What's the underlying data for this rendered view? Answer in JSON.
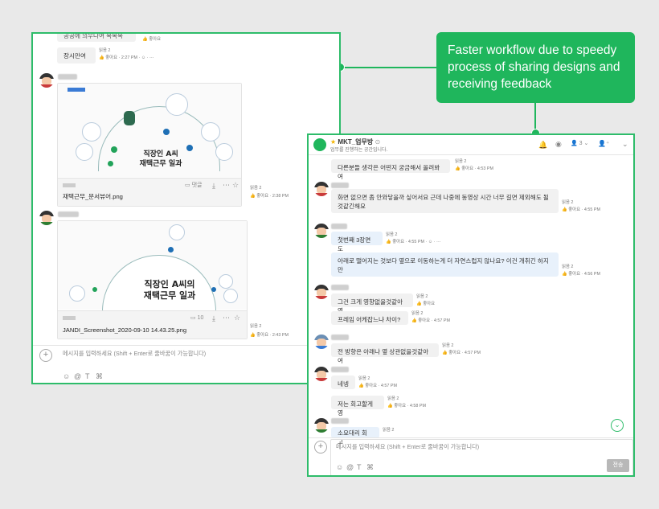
{
  "callout": {
    "text": "Faster workflow due to speedy process of sharing designs and receiving feedback"
  },
  "left": {
    "top_bubble_partial": "공공에 의우나여 목목목",
    "top_bubble_meta": "좋아요",
    "msg1": {
      "text": "장시만여",
      "read": "읽음 2",
      "like": "좋아요",
      "time": "2:27 PM"
    },
    "file1": {
      "image_title_line1": "직장인 A씨",
      "image_title_line2": "재택근무 일과",
      "comment_label": "댓글",
      "filename": "재택근무_문서뷰어.png",
      "read": "읽음 2",
      "like": "좋아요",
      "time": "2:38 PM"
    },
    "file2": {
      "image_title_line1": "직장인 A씨의",
      "image_title_line2": "재택근무 일과",
      "comment_count": "10",
      "filename": "JANDI_Screenshot_2020-09-10 14.43.25.png",
      "read": "읽음 2",
      "like": "좋아요",
      "time": "2:43 PM"
    },
    "input": {
      "placeholder": "메시지를 입력하세요 (Shift + Enter로 줄바꿈이 가능합니다)"
    }
  },
  "right": {
    "header": {
      "title": "MKT_업무방",
      "subtitle": "업무를 진행하는 공간입니다.",
      "member_count": "3"
    },
    "messages": [
      {
        "text": "다른분들 생각은 어떤지 궁금해서 올려봐여",
        "read": "읽음 2",
        "like": "좋아요",
        "time": "4:53 PM"
      },
      {
        "text": "화면 없으면 좀 안와닿을까 싶어서요 근데 나중에 동영상 시간 너무 길면 제외해도 될 것같긴해요",
        "read": "읽음 2",
        "like": "좋아요",
        "time": "4:55 PM"
      },
      {
        "text": "첫번째 3장면도",
        "read": "읽음 2",
        "like": "좋아요",
        "time": "4:55 PM"
      },
      {
        "text": "아래로 떨어지는 것보다 옆으로 이동하는게 더 자연스럽지 않나요? 이건 개취긴 하지만",
        "read": "읽음 2",
        "like": "좋아요",
        "time": "4:56 PM"
      },
      {
        "text": "그건 크게 영향없을것같아영",
        "read": "읽음 2",
        "like": "좋아요",
        "time": ""
      },
      {
        "text": "프레임 어케잡느냐 차이?",
        "read": "읽음 2",
        "like": "좋아요",
        "time": "4:57 PM"
      },
      {
        "text": "전 방향은 아래나 옆 상관없을것같아여",
        "read": "읽음 2",
        "like": "좋아요",
        "time": "4:57 PM"
      },
      {
        "text": "네넹",
        "read": "읽음 2",
        "like": "좋아요",
        "time": "4:57 PM"
      },
      {
        "text": "저는 회고할게영",
        "read": "읽음 2",
        "like": "좋아요",
        "time": "4:58 PM"
      },
      {
        "text": "소요대리 회고",
        "read": "읽음 2",
        "like": "",
        "time": ""
      }
    ],
    "input": {
      "placeholder": "메시지를 입력하세요 (Shift + Enter로 줄바꿈이 가능합니다)",
      "send_label": "전송"
    }
  },
  "colors": {
    "accent": "#1fb65c",
    "border": "#2ebc6a"
  }
}
